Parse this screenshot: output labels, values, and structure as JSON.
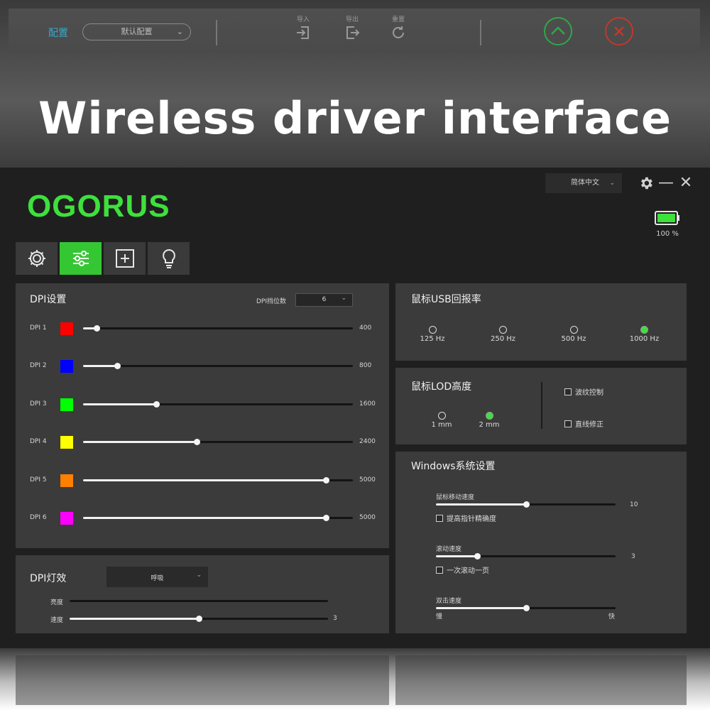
{
  "banner": {
    "title": "Wireless driver interface",
    "ghost_toolbar": {
      "config_label": "配置",
      "config_select": "默认配置",
      "tools": [
        "导入",
        "导出",
        "重置"
      ],
      "confirm_color": "#2fa84a",
      "cancel_color": "#c0392b"
    }
  },
  "app": {
    "logo": "OGORUS",
    "language": "简体中文",
    "battery_text": "100 %",
    "battery_level": 1.0,
    "accent": "#3ee03c",
    "tabs": [
      {
        "name": "settings",
        "icon": "gear-icon",
        "active": false
      },
      {
        "name": "adjust",
        "icon": "sliders-icon",
        "active": true
      },
      {
        "name": "macro",
        "icon": "plus-box-icon",
        "active": false
      },
      {
        "name": "lighting",
        "icon": "bulb-icon",
        "active": false
      }
    ]
  },
  "dpi": {
    "title": "DPI设置",
    "levels_label": "DPI挡位数",
    "levels_value": "6",
    "max_dpi": 5000,
    "rows": [
      {
        "label": "DPI 1",
        "color": "#ff0000",
        "value": "400",
        "fraction": 0.05
      },
      {
        "label": "DPI 2",
        "color": "#0000ff",
        "value": "800",
        "fraction": 0.125
      },
      {
        "label": "DPI 3",
        "color": "#00ff00",
        "value": "1600",
        "fraction": 0.27
      },
      {
        "label": "DPI 4",
        "color": "#ffff00",
        "value": "2400",
        "fraction": 0.42
      },
      {
        "label": "DPI 5",
        "color": "#ff8000",
        "value": "5000",
        "fraction": 0.9
      },
      {
        "label": "DPI 6",
        "color": "#ff00ff",
        "value": "5000",
        "fraction": 0.9
      }
    ]
  },
  "dpi_light": {
    "title": "DPI灯效",
    "mode": "呼吸",
    "brightness_label": "亮度",
    "brightness_fraction": 0.0,
    "speed_label": "速度",
    "speed_value": "3",
    "speed_fraction": 0.5
  },
  "usb": {
    "title": "鼠标USB回报率",
    "options": [
      {
        "label": "125 Hz",
        "selected": false
      },
      {
        "label": "250 Hz",
        "selected": false
      },
      {
        "label": "500 Hz",
        "selected": false
      },
      {
        "label": "1000 Hz",
        "selected": true
      }
    ]
  },
  "lod": {
    "title": "鼠标LOD高度",
    "options": [
      {
        "label": "1 mm",
        "selected": false
      },
      {
        "label": "2 mm",
        "selected": true
      }
    ],
    "ripple_label": "波纹控制",
    "straight_label": "直线修正"
  },
  "windows": {
    "title": "Windows系统设置",
    "mouse_speed_label": "鼠标移动速度",
    "mouse_speed_value": "10",
    "mouse_speed_fraction": 0.5,
    "precision_label": "提高指针精确度",
    "scroll_label": "滚动速度",
    "scroll_value": "3",
    "scroll_fraction": 0.23,
    "scroll_page_label": "一次滚动一页",
    "dblclick_label": "双击速度",
    "dblclick_fraction": 0.5,
    "slow_label": "慢",
    "fast_label": "快"
  }
}
